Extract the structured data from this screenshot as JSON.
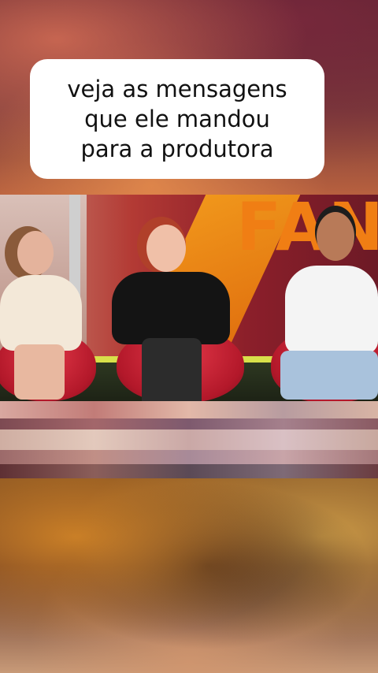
{
  "caption": {
    "text": "veja as mensagens\nque ele mandou\npara a produtora"
  },
  "video": {
    "logo_text": "FAN"
  }
}
